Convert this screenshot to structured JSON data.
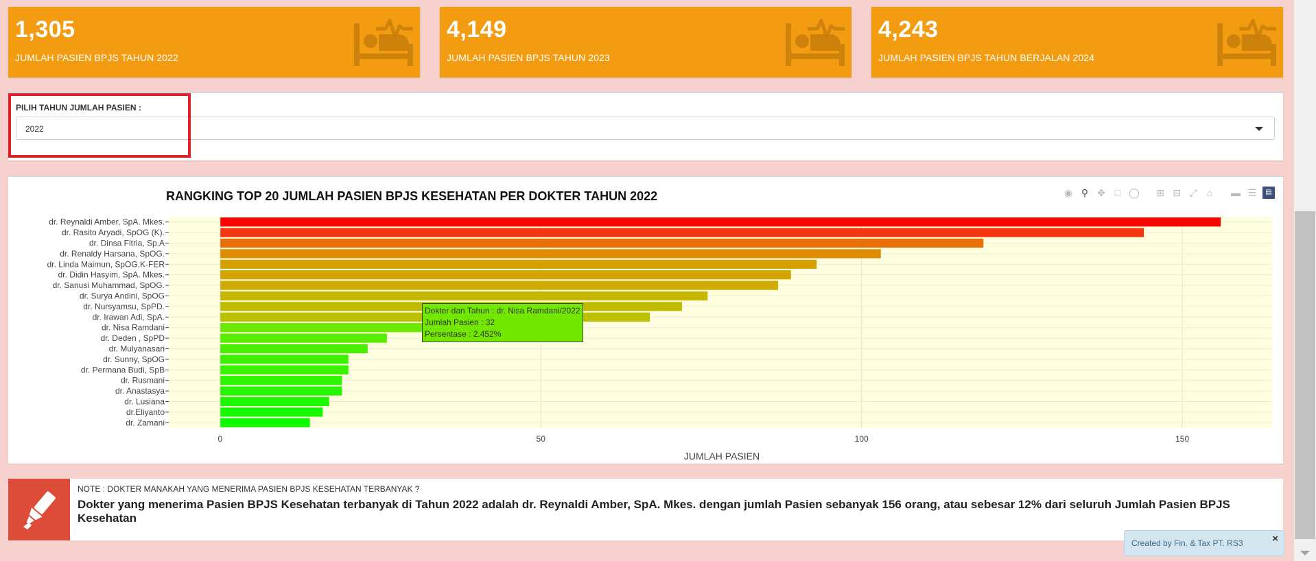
{
  "value_boxes": [
    {
      "value": "1,305",
      "label": "JUMLAH PASIEN BPJS TAHUN 2022",
      "icon": "bed-heartbeat-icon"
    },
    {
      "value": "4,149",
      "label": "JUMLAH PASIEN BPJS TAHUN 2023",
      "icon": "bed-heartbeat-icon"
    },
    {
      "value": "4,243",
      "label": "JUMLAH PASIEN BPJS TAHUN BERJALAN 2024",
      "icon": "bed-heartbeat-icon"
    }
  ],
  "filter": {
    "label": "PILIH TAHUN JUMLAH PASIEN :",
    "selected": "2022"
  },
  "chart_data": {
    "type": "bar",
    "orientation": "horizontal",
    "title": "RANGKING TOP 20 JUMLAH PASIEN BPJS KESEHATAN PER DOKTER TAHUN 2022",
    "xlabel": "JUMLAH PASIEN",
    "ylabel": "",
    "xlim": [
      -8,
      164
    ],
    "xticks": [
      0,
      50,
      100,
      150
    ],
    "grid": true,
    "plot_background": "#ffffe0",
    "categories": [
      "dr. Reynaldi Amber, SpA. Mkes.",
      "dr. Rasito Aryadi, SpOG (K).",
      "dr. Dinsa Fitria, Sp.A",
      "dr. Renaldy Harsana, SpOG.",
      "dr. Linda Maimun, SpOG.K-FER",
      "dr. Didin Hasyim, SpA. Mkes.",
      "dr. Sanusi Muhammad, SpOG.",
      "dr. Surya Andini, SpOG",
      "dr. Nursyamsu, SpPD.",
      "dr. Irawan Adi, SpA.",
      "dr. Nisa Ramdani",
      "dr. Deden , SpPD",
      "dr. Mulyanasari",
      "dr. Sunny, SpOG",
      "dr. Permana Budi, SpB",
      "dr. Rusmani",
      "dr. Anastasya",
      "dr. Lusiana",
      "dr.Eliyanto",
      "dr. Zamani"
    ],
    "values": [
      156,
      144,
      119,
      103,
      93,
      89,
      87,
      76,
      72,
      67,
      32,
      26,
      23,
      20,
      20,
      19,
      19,
      17,
      16,
      14
    ],
    "colors": [
      "#f70500",
      "#f53410",
      "#e86e08",
      "#dd8c00",
      "#d6a000",
      "#d2a500",
      "#cfaa00",
      "#c6b600",
      "#c0bb00",
      "#bbc000",
      "#6ee800",
      "#5aec00",
      "#4aee00",
      "#3cf200",
      "#38f200",
      "#2cf600",
      "#28f600",
      "#1cf800",
      "#14fa00",
      "#0cfc00"
    ]
  },
  "tooltip": {
    "line1": "Dokter dan Tahun : dr. Nisa Ramdani/2022",
    "line2": "Jumlah Pasien : 32",
    "line3": "Persentase : 2.452%"
  },
  "modebar": {
    "icons": [
      "camera-icon",
      "zoom-icon",
      "pan-icon",
      "box-select-icon",
      "lasso-icon",
      "zoom-in-icon",
      "zoom-out-icon",
      "autoscale-icon",
      "reset-axes-icon",
      "spike-lines-icon",
      "compare-hover-icon",
      "plotly-logo-icon"
    ]
  },
  "note": {
    "title": "NOTE : DOKTER MANAKAH YANG MENERIMA PASIEN BPJS KESEHATAN TERBANYAK ?",
    "text": "Dokter yang menerima Pasien BPJS Kesehatan terbanyak di Tahun 2022 adalah dr. Reynaldi Amber, SpA. Mkes. dengan jumlah Pasien sebanyak 156 orang, atau sebesar 12% dari seluruh Jumlah Pasien BPJS Kesehatan",
    "icon": "highlighter-icon"
  },
  "notification": {
    "message": "Created by Fin. & Tax PT. RS3",
    "close": "×"
  },
  "colors": {
    "page_bg": "#f6d1cd",
    "value_box": "#f39c12",
    "highlight_border": "#e0202a",
    "note_icon_bg": "#dd4b39"
  }
}
